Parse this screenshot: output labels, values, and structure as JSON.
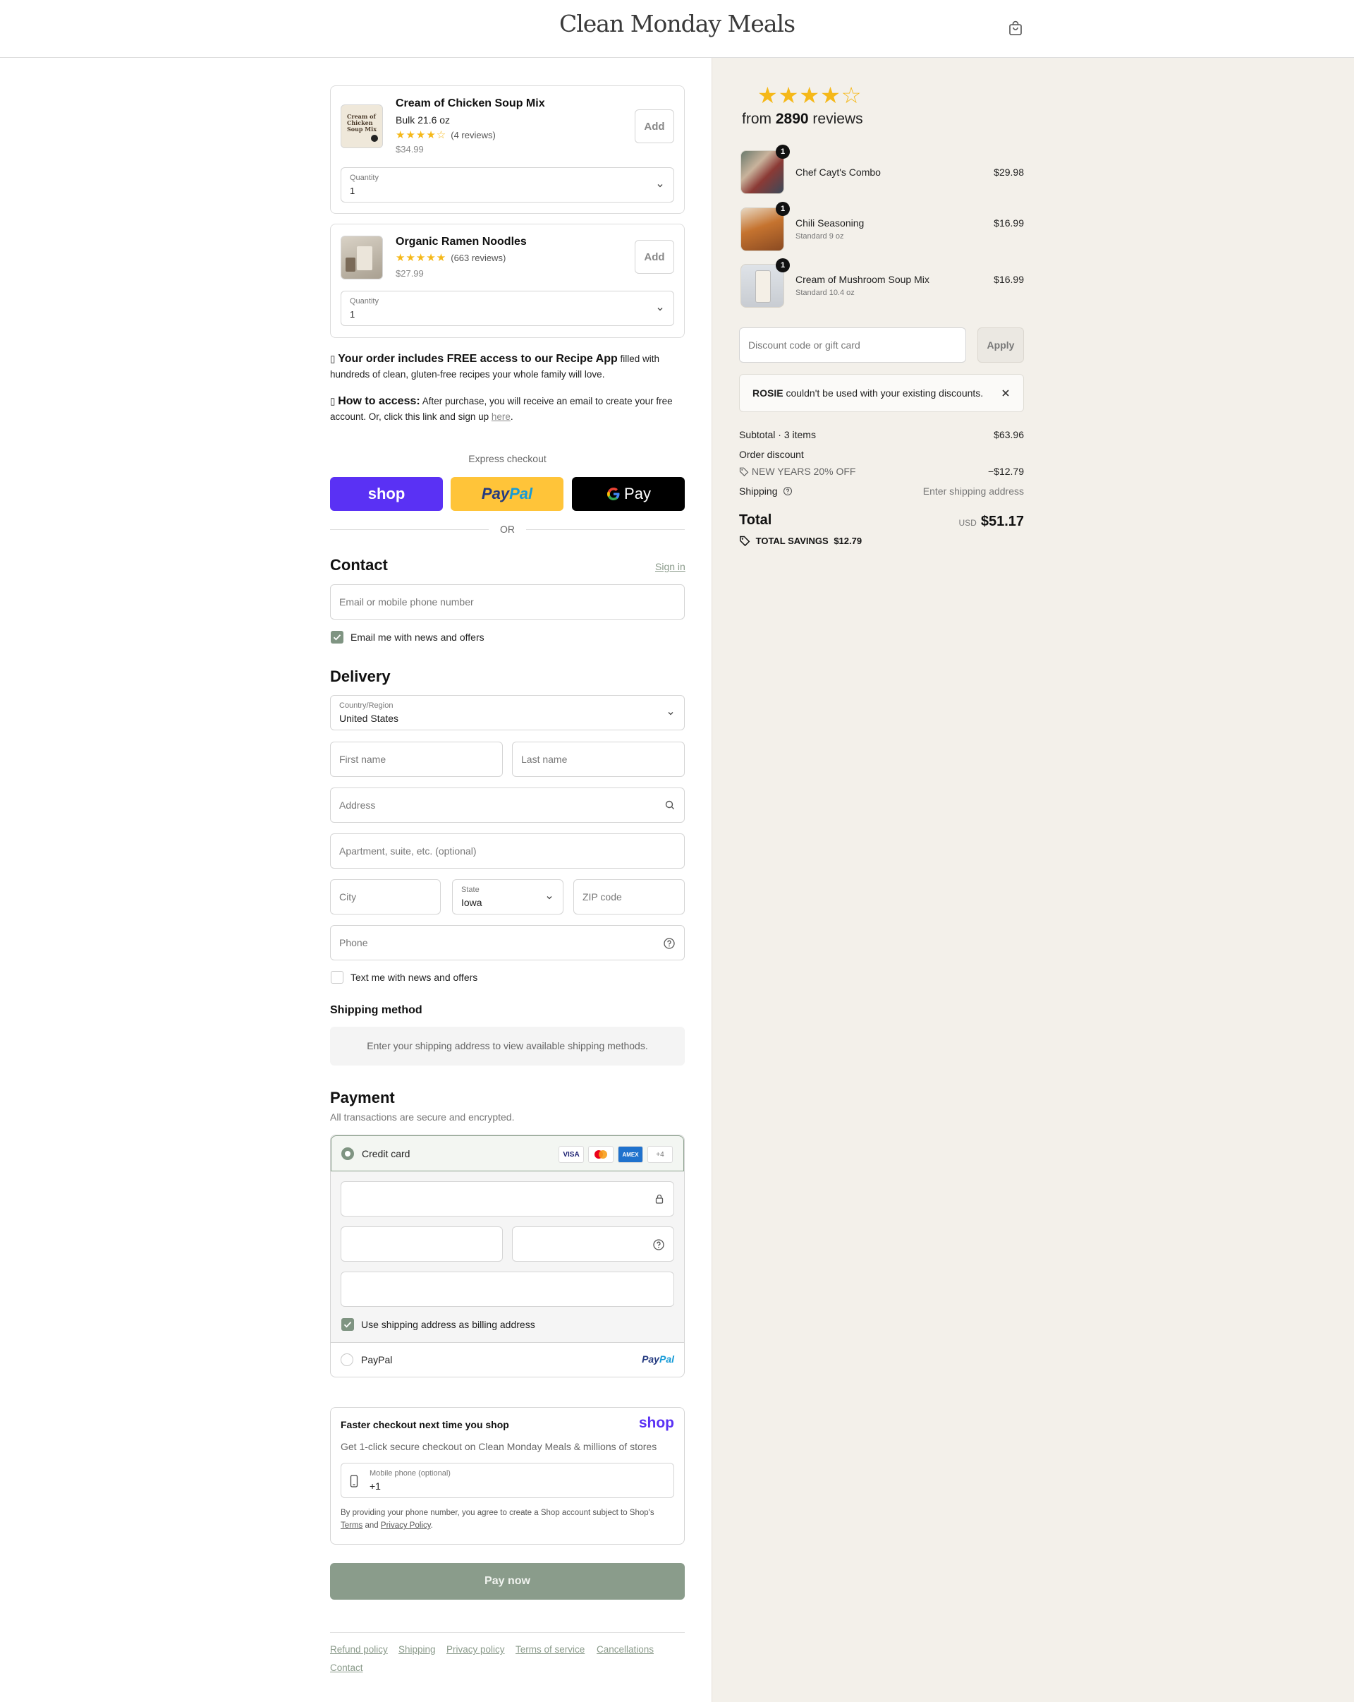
{
  "header": {
    "brand": "Clean Monday Meals",
    "cart_icon": "shopping-bag-icon"
  },
  "upsells": [
    {
      "title": "Cream of Chicken Soup Mix",
      "variant": "Bulk 21.6 oz",
      "stars": "★★★★☆",
      "reviews": "(4 reviews)",
      "price": "$34.99",
      "add_label": "Add",
      "qty_label": "Quantity",
      "qty_value": "1",
      "thumb_label": "Cream of Chicken Soup Mix"
    },
    {
      "title": "Organic Ramen Noodles",
      "variant": "",
      "stars": "★★★★★",
      "reviews": "(663 reviews)",
      "price": "$27.99",
      "add_label": "Add",
      "qty_label": "Quantity",
      "qty_value": "1"
    }
  ],
  "notes": {
    "recipe_bold": "Your order includes FREE access to our Recipe App",
    "recipe_rest": " filled with hundreds of clean, gluten-free recipes your whole family will love.",
    "access_bold": "How to access:",
    "access_rest": " After purchase, you will receive an email to create your free account. Or, click this link and sign up ",
    "access_link": "here",
    "access_end": "."
  },
  "express": {
    "label": "Express checkout",
    "shop": "shop",
    "paypal_a": "Pay",
    "paypal_b": "Pal",
    "gpay": "Pay",
    "or": "OR"
  },
  "contact": {
    "title": "Contact",
    "sign_in": "Sign in",
    "email_placeholder": "Email or mobile phone number",
    "news_label": "Email me with news and offers",
    "news_checked": true
  },
  "delivery": {
    "title": "Delivery",
    "country_label": "Country/Region",
    "country_value": "United States",
    "first_name": "First name",
    "last_name": "Last name",
    "address": "Address",
    "apartment": "Apartment, suite, etc. (optional)",
    "city": "City",
    "state_label": "State",
    "state_value": "Iowa",
    "zip": "ZIP code",
    "phone": "Phone",
    "text_label": "Text me with news and offers",
    "text_checked": false
  },
  "shipping_method": {
    "title": "Shipping method",
    "message": "Enter your shipping address to view available shipping methods."
  },
  "payment": {
    "title": "Payment",
    "subtitle": "All transactions are secure and encrypted.",
    "credit_card": "Credit card",
    "cards": [
      "VISA",
      "MC",
      "AMEX",
      "+4"
    ],
    "billing_label": "Use shipping address as billing address",
    "billing_checked": true,
    "paypal_label": "PayPal",
    "paypal_logo_a": "Pay",
    "paypal_logo_b": "Pal"
  },
  "shop_pay": {
    "title": "Faster checkout next time you shop",
    "logo": "shop",
    "subtitle": "Get 1-click secure checkout on Clean Monday Meals & millions of stores",
    "phone_label": "Mobile phone (optional)",
    "phone_value": "+1",
    "legal": "By providing your phone number, you agree to create a Shop account subject to Shop's",
    "terms": "Terms",
    "and": "and",
    "privacy": "Privacy Policy",
    "end": "."
  },
  "pay_now": "Pay now",
  "footer": {
    "links": [
      "Refund policy",
      "Shipping",
      "Privacy policy",
      "Terms of service",
      "Cancellations",
      "Contact"
    ]
  },
  "summary": {
    "stars": "★★★★☆",
    "reviews_prefix": "from ",
    "reviews_count": "2890",
    "reviews_suffix": " reviews",
    "items": [
      {
        "name": "Chef Cayt's Combo",
        "variant": "",
        "price": "$29.98",
        "qty": "1"
      },
      {
        "name": "Chili Seasoning",
        "variant": "Standard 9 oz",
        "price": "$16.99",
        "qty": "1"
      },
      {
        "name": "Cream of Mushroom Soup Mix",
        "variant": "Standard 10.4 oz",
        "price": "$16.99",
        "qty": "1"
      }
    ],
    "discount_placeholder": "Discount code or gift card",
    "apply": "Apply",
    "warning_code": "ROSIE",
    "warning_text": " couldn't be used with your existing discounts.",
    "subtotal_label": "Subtotal · 3 items",
    "subtotal": "$63.96",
    "order_discount_label": "Order discount",
    "discount_code": "NEW YEARS 20% OFF",
    "discount_amount": "−$12.79",
    "shipping_label": "Shipping",
    "shipping_value": "Enter shipping address",
    "total_label": "Total",
    "currency": "USD",
    "total": "$51.17",
    "savings_label": "TOTAL SAVINGS",
    "savings": "$12.79"
  },
  "colors": {
    "accent": "#7f9482",
    "shop_purple": "#5a31f4",
    "paypal_yellow": "#ffc439",
    "star": "#f5b819",
    "summary_bg": "#f3f0ea"
  }
}
